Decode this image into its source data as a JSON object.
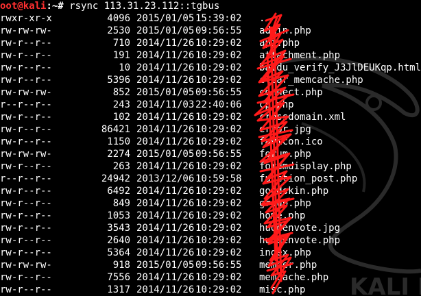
{
  "prompt": {
    "user": "oot@kali",
    "rest": ":~#",
    "command": "rsync 113.31.23.112::tgbus"
  },
  "watermark": {
    "text": "KALI LIN"
  },
  "colors": {
    "background": "#000000",
    "prompt_user": "#ff3030",
    "text": "#ffffff",
    "redaction": "#ff1a1a"
  },
  "rows": [
    {
      "perm": "rwxr-xr-x",
      "size": "4096",
      "date": "2015/01/05",
      "time": "15:39:02",
      "name": "."
    },
    {
      "perm": "rw-rw-rw-",
      "size": "2530",
      "date": "2015/01/05",
      "time": "09:56:55",
      "name": "admin.php"
    },
    {
      "perm": "rw-r--r--",
      "size": "710",
      "date": "2014/11/26",
      "time": "10:29:02",
      "name": "api.php"
    },
    {
      "perm": "rw-r--r--",
      "size": "191",
      "date": "2014/11/26",
      "time": "10:29:02",
      "name": "attachment.php"
    },
    {
      "perm": "rw-r--r--",
      "size": "10",
      "date": "2014/11/26",
      "time": "10:29:02",
      "name": "baidu_verify_J3JlDEUKqp.html"
    },
    {
      "perm": "rw-r--r--",
      "size": "5396",
      "date": "2014/11/26",
      "time": "10:29:02",
      "name": "clear_memcache.php"
    },
    {
      "perm": "rw-rw-rw-",
      "size": "852",
      "date": "2015/01/05",
      "time": "09:56:55",
      "name": "connect.php"
    },
    {
      "perm": "r--r--r--",
      "size": "243",
      "date": "2014/11/03",
      "time": "22:40:06",
      "name": "cp.php"
    },
    {
      "perm": "rw-r--r--",
      "size": "102",
      "date": "2014/11/26",
      "time": "10:29:02",
      "name": "crossdomain.xml"
    },
    {
      "perm": "rw-r--r--",
      "size": "86421",
      "date": "2014/11/26",
      "time": "10:29:02",
      "name": "error.jpg"
    },
    {
      "perm": "rw-r--r--",
      "size": "1150",
      "date": "2014/11/26",
      "time": "10:29:02",
      "name": "favicon.ico"
    },
    {
      "perm": "rw-rw-rw-",
      "size": "2274",
      "date": "2015/01/05",
      "time": "09:56:55",
      "name": "forum.php"
    },
    {
      "perm": "rw-r--r--",
      "size": "263",
      "date": "2014/11/26",
      "time": "10:29:02",
      "name": "forumdisplay.php"
    },
    {
      "perm": "r--r--r--",
      "size": "24942",
      "date": "2013/12/06",
      "time": "10:59:58",
      "name": "function_post.php"
    },
    {
      "perm": "rw-r--r--",
      "size": "6492",
      "date": "2014/11/26",
      "time": "10:29:02",
      "name": "goodskin.php"
    },
    {
      "perm": "rw-r--r--",
      "size": "849",
      "date": "2014/11/26",
      "time": "10:29:02",
      "name": "group.php"
    },
    {
      "perm": "rw-r--r--",
      "size": "1053",
      "date": "2014/11/26",
      "time": "10:29:02",
      "name": "home.php"
    },
    {
      "perm": "rw-r--r--",
      "size": "3543",
      "date": "2014/11/26",
      "time": "10:29:02",
      "name": "huodenvote.jpg"
    },
    {
      "perm": "rw-r--r--",
      "size": "2640",
      "date": "2014/11/26",
      "time": "10:29:02",
      "name": "huodenvote.php"
    },
    {
      "perm": "rw-r--r--",
      "size": "5364",
      "date": "2014/11/26",
      "time": "10:29:02",
      "name": "index.php"
    },
    {
      "perm": "rw-rw-rw-",
      "size": "918",
      "date": "2015/01/05",
      "time": "09:56:55",
      "name": "member.php"
    },
    {
      "perm": "rw-r--r--",
      "size": "7556",
      "date": "2014/11/26",
      "time": "10:29:02",
      "name": "memcache.php"
    },
    {
      "perm": "rw-r--r--",
      "size": "1317",
      "date": "2014/11/26",
      "time": "10:29:02",
      "name": "misc.php"
    }
  ]
}
